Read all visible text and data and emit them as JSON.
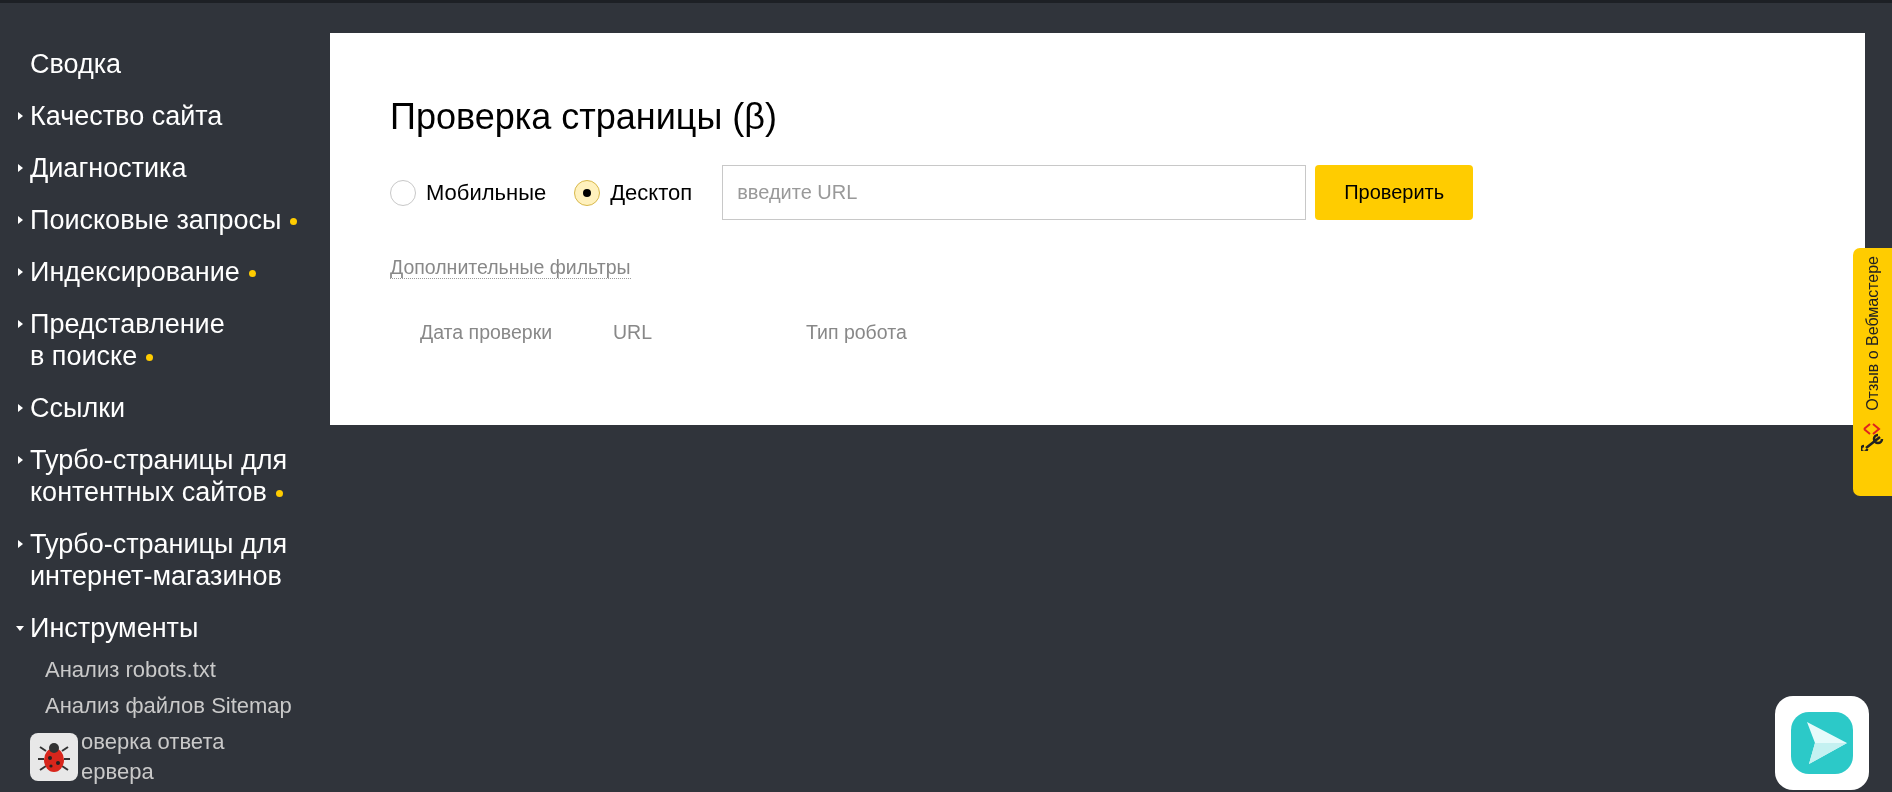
{
  "sidebar": {
    "items": [
      {
        "lines": [
          "Сводка"
        ],
        "dot": false
      },
      {
        "lines": [
          "Качество сайта"
        ],
        "expanded": false,
        "dot": false
      },
      {
        "lines": [
          "Диагностика"
        ],
        "expanded": false,
        "dot": false
      },
      {
        "lines": [
          "Поисковые запросы"
        ],
        "expanded": false,
        "dot": true
      },
      {
        "lines": [
          "Индексирование"
        ],
        "expanded": false,
        "dot": true
      },
      {
        "lines": [
          "Представление",
          "в поиске"
        ],
        "expanded": false,
        "dot": true
      },
      {
        "lines": [
          "Ссылки"
        ],
        "expanded": false,
        "dot": false
      },
      {
        "lines": [
          "Турбо-страницы для",
          "контентных сайтов"
        ],
        "expanded": false,
        "dot": true
      },
      {
        "lines": [
          "Турбо-страницы для",
          "интернет-магазинов"
        ],
        "expanded": false,
        "dot": false
      },
      {
        "lines": [
          "Инструменты"
        ],
        "expanded": true,
        "dot": false,
        "children": [
          {
            "lines": [
              "Анализ robots.txt"
            ],
            "covered": false
          },
          {
            "lines": [
              "Анализ файлов Sitemap"
            ],
            "covered": false
          },
          {
            "lines": [
              "оверка ответа",
              "ервера"
            ],
            "covered": true
          }
        ]
      }
    ]
  },
  "page": {
    "title": "Проверка страницы (β)",
    "modes": [
      {
        "label": "Мобильные",
        "selected": false
      },
      {
        "label": "Десктоп",
        "selected": true
      }
    ],
    "url_field": {
      "placeholder": "введите URL"
    },
    "check_button": "Проверить",
    "filters_link": "Дополнительные фильтры",
    "columns": [
      "Дата проверки",
      "URL",
      "Тип робота"
    ]
  },
  "feedback_tab": {
    "label": "Отзыв о Вебмастере"
  }
}
